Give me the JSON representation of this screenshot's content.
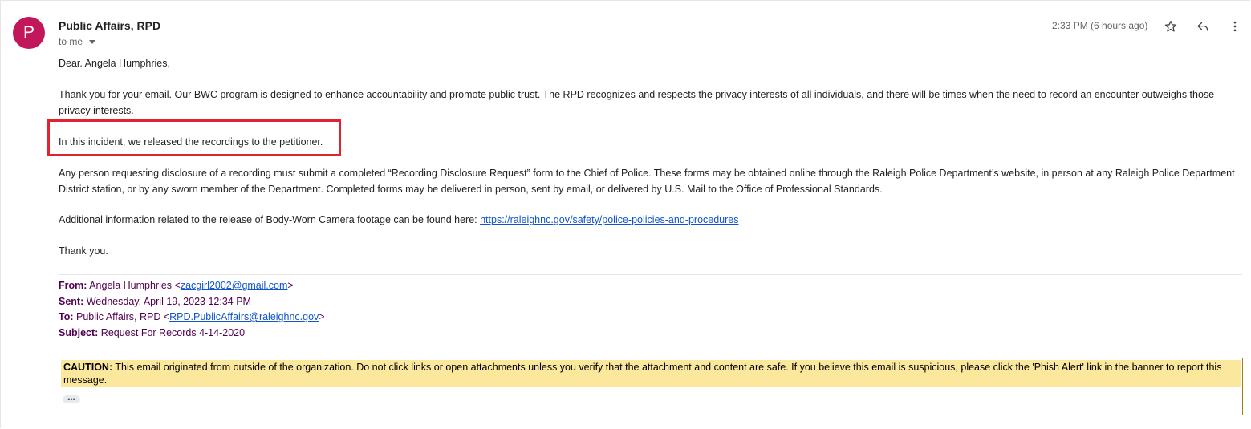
{
  "header": {
    "avatar_letter": "P",
    "avatar_color": "#c2185b",
    "sender": "Public Affairs, RPD",
    "to_me": "to me",
    "timestamp": "2:33 PM (6 hours ago)",
    "icons": [
      "star-icon",
      "reply-icon",
      "more-vert-icon"
    ]
  },
  "body": {
    "greeting": "Dear. Angela Humphries,",
    "para1": "Thank you for your email. Our BWC program is designed to enhance accountability and promote public trust. The RPD recognizes and respects the privacy interests of all individuals, and there will be times when the need to record an encounter outweighs those privacy interests.",
    "para2": "In this incident, we released the recordings to the petitioner.",
    "para3": "Any person requesting disclosure of a recording must submit a completed “Recording Disclosure Request” form to the Chief of Police. These forms may be obtained online through the Raleigh Police Department’s website, in person at any Raleigh Police Department District station, or by any sworn member of the Department. Completed forms may be delivered in person, sent by email, or delivered by U.S. Mail to the Office of Professional Standards.",
    "para4_prefix": "Additional information related to the release of Body-Worn Camera footage can be found here: ",
    "para4_link": "https://raleighnc.gov/safety/police-policies-and-procedures",
    "closing": "Thank you.",
    "highlight_color": "#e0232f"
  },
  "quoted": {
    "from_label": "From:",
    "from_name": "Angela Humphries <",
    "from_email": "zacgirl2002@gmail.com",
    "from_end": ">",
    "sent_label": "Sent:",
    "sent_value": "Wednesday, April 19, 2023 12:34 PM",
    "to_label": "To:",
    "to_name": "Public Affairs, RPD <",
    "to_email": "RPD.PublicAffairs@raleighnc.gov",
    "to_end": ">",
    "subject_label": "Subject:",
    "subject_value": "Request For Records 4-14-2020"
  },
  "caution": {
    "label": "CAUTION:",
    "text": " This email originated from outside of the organization. Do not click links or open attachments unless you verify that the attachment and content are safe. If you believe this email is suspicious, please click the 'Phish Alert' link in the banner to report this message.",
    "banner_color": "#fbe89c",
    "more_label": "•••"
  }
}
